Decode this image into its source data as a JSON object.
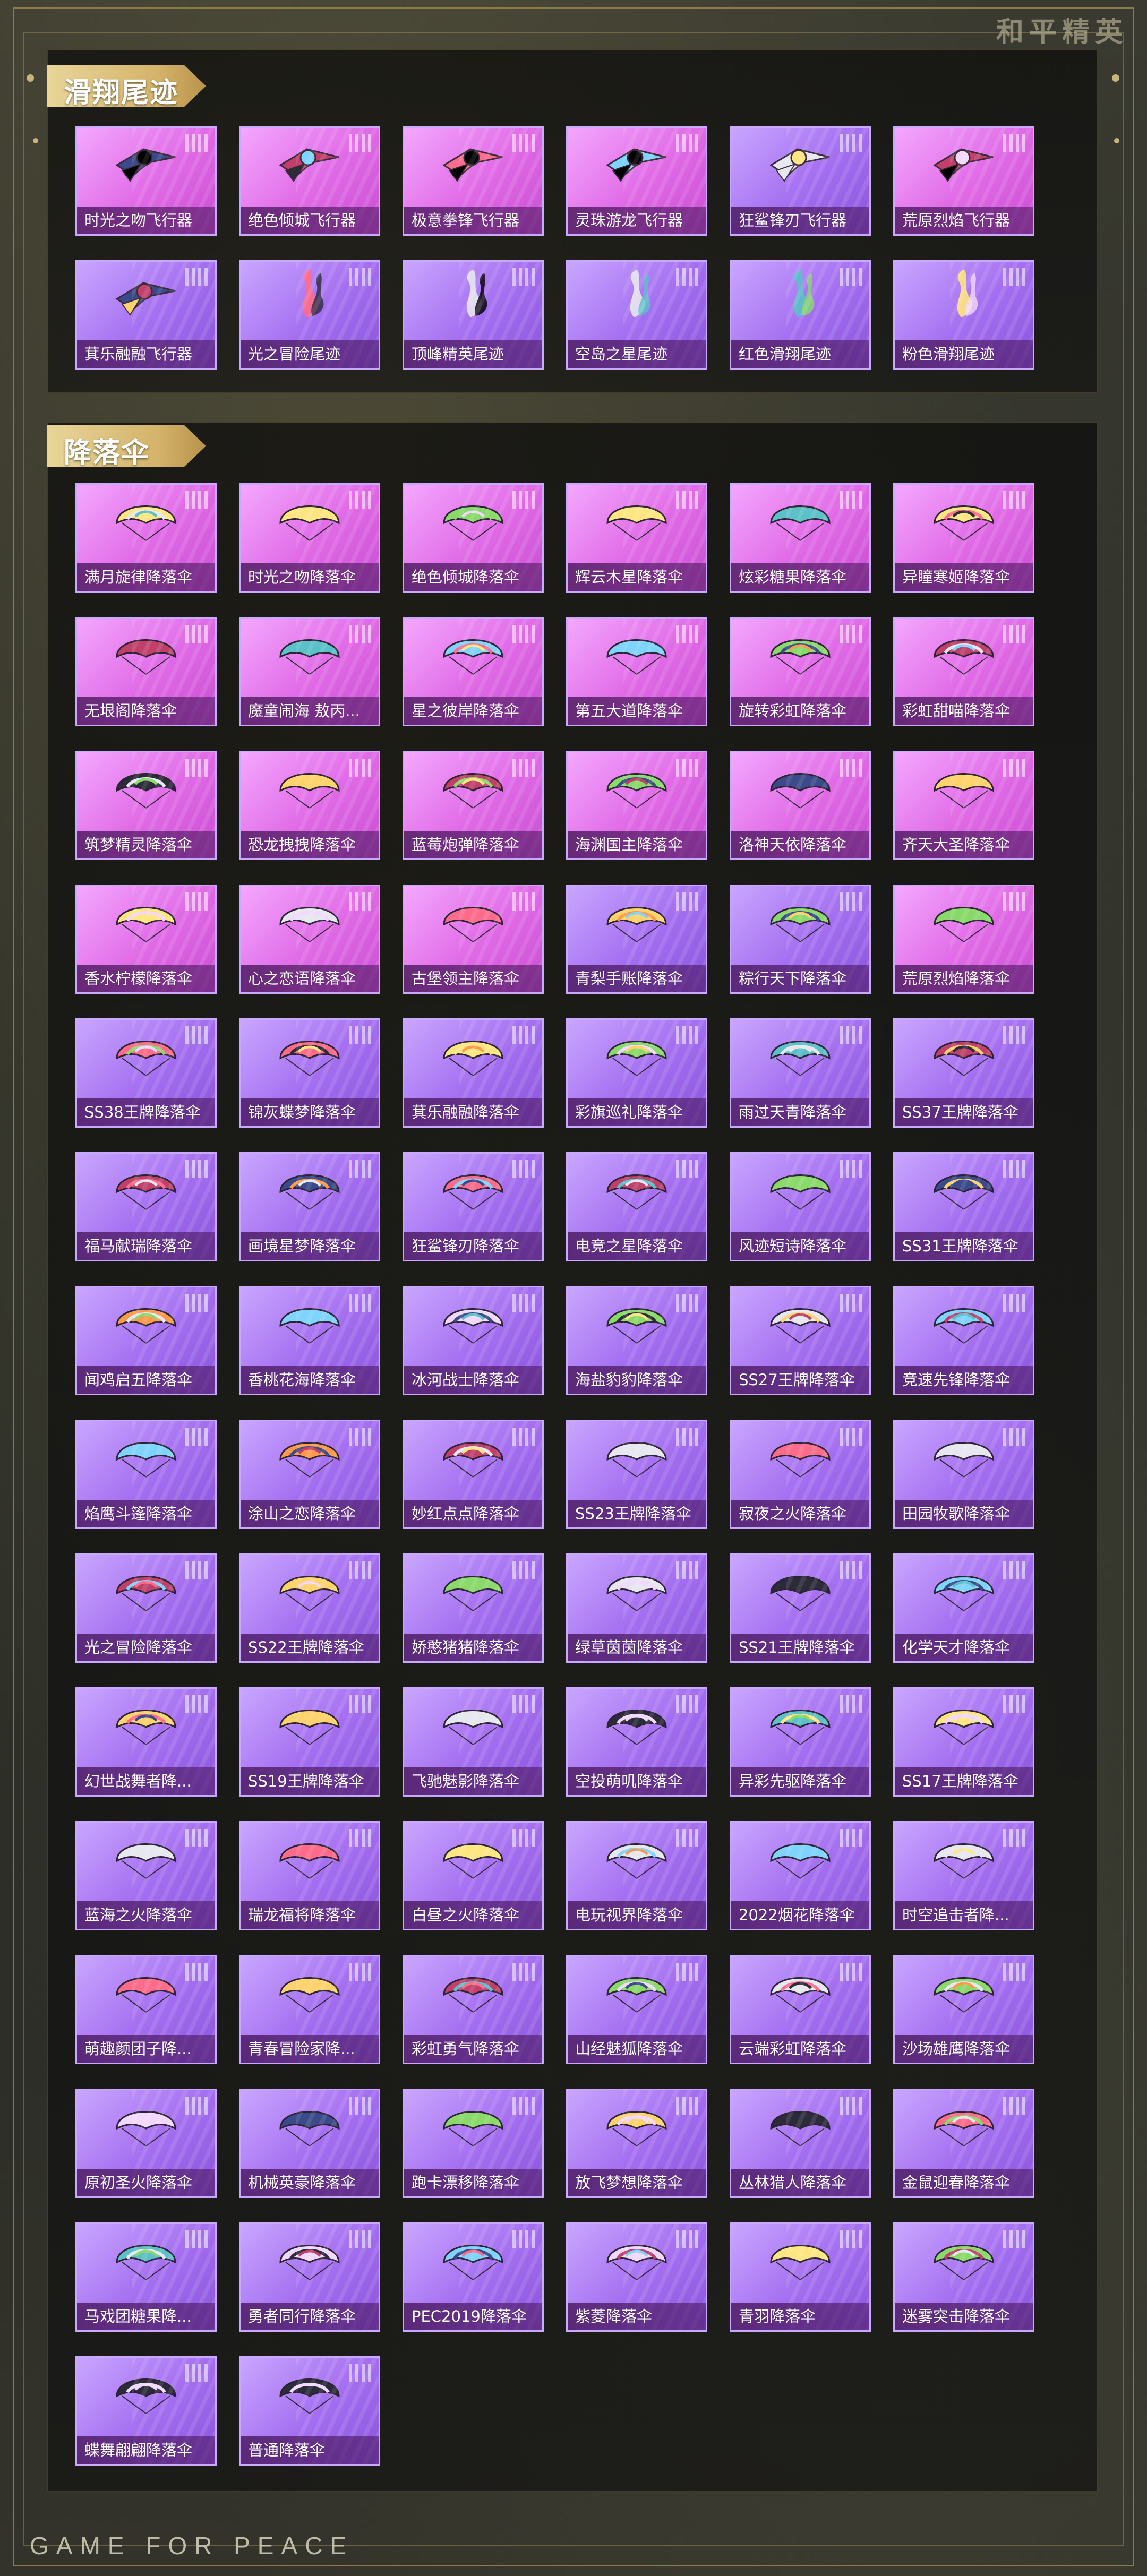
{
  "brand": {
    "corner_title": "和平精英",
    "footer": "GAME FOR PEACE"
  },
  "sections": [
    {
      "title": "滑翔尾迹",
      "items": [
        {
          "name": "时光之吻飞行器",
          "icon": "glider-icon",
          "bg": "pink"
        },
        {
          "name": "绝色倾城飞行器",
          "icon": "glider-icon",
          "bg": "pink"
        },
        {
          "name": "极意拳锋飞行器",
          "icon": "glider-icon",
          "bg": "pink"
        },
        {
          "name": "灵珠游龙飞行器",
          "icon": "glider-icon",
          "bg": "pink"
        },
        {
          "name": "狂鲨锋刃飞行器",
          "icon": "glider-icon",
          "bg": "purple"
        },
        {
          "name": "荒原烈焰飞行器",
          "icon": "glider-icon",
          "bg": "pink"
        },
        {
          "name": "萁乐融融飞行器",
          "icon": "glider-icon",
          "bg": "purple"
        },
        {
          "name": "光之冒险尾迹",
          "icon": "trail-icon",
          "bg": "purple"
        },
        {
          "name": "顶峰精英尾迹",
          "icon": "trail-icon",
          "bg": "purple"
        },
        {
          "name": "空岛之星尾迹",
          "icon": "trail-icon",
          "bg": "purple"
        },
        {
          "name": "红色滑翔尾迹",
          "icon": "trail-icon",
          "bg": "purple"
        },
        {
          "name": "粉色滑翔尾迹",
          "icon": "trail-icon",
          "bg": "purple"
        }
      ]
    },
    {
      "title": "降落伞",
      "items": [
        {
          "name": "满月旋律降落伞",
          "icon": "parachute-icon",
          "bg": "pink"
        },
        {
          "name": "时光之吻降落伞",
          "icon": "parachute-icon",
          "bg": "pink"
        },
        {
          "name": "绝色倾城降落伞",
          "icon": "parachute-icon",
          "bg": "pink"
        },
        {
          "name": "辉云木星降落伞",
          "icon": "parachute-icon",
          "bg": "pink"
        },
        {
          "name": "炫彩糖果降落伞",
          "icon": "parachute-icon",
          "bg": "pink"
        },
        {
          "name": "异瞳寒姬降落伞",
          "icon": "parachute-icon",
          "bg": "pink"
        },
        {
          "name": "无垠阁降落伞",
          "icon": "parachute-icon",
          "bg": "pink"
        },
        {
          "name": "魔童闹海 敖丙...",
          "icon": "parachute-icon",
          "bg": "pink"
        },
        {
          "name": "星之彼岸降落伞",
          "icon": "parachute-icon",
          "bg": "pink"
        },
        {
          "name": "第五大道降落伞",
          "icon": "parachute-icon",
          "bg": "pink"
        },
        {
          "name": "旋转彩虹降落伞",
          "icon": "parachute-icon",
          "bg": "pink"
        },
        {
          "name": "彩虹甜喵降落伞",
          "icon": "parachute-icon",
          "bg": "pink"
        },
        {
          "name": "筑梦精灵降落伞",
          "icon": "parachute-icon",
          "bg": "pink"
        },
        {
          "name": "恐龙拽拽降落伞",
          "icon": "parachute-icon",
          "bg": "pink"
        },
        {
          "name": "蓝莓炮弹降落伞",
          "icon": "parachute-icon",
          "bg": "pink"
        },
        {
          "name": "海渊国主降落伞",
          "icon": "parachute-icon",
          "bg": "pink"
        },
        {
          "name": "洛神天依降落伞",
          "icon": "parachute-icon",
          "bg": "pink"
        },
        {
          "name": "齐天大圣降落伞",
          "icon": "parachute-icon",
          "bg": "pink"
        },
        {
          "name": "香水柠檬降落伞",
          "icon": "parachute-icon",
          "bg": "pink"
        },
        {
          "name": "心之恋语降落伞",
          "icon": "parachute-icon",
          "bg": "pink"
        },
        {
          "name": "古堡领主降落伞",
          "icon": "parachute-icon",
          "bg": "pink"
        },
        {
          "name": "青梨手账降落伞",
          "icon": "parachute-icon",
          "bg": "purple"
        },
        {
          "name": "粽行天下降落伞",
          "icon": "parachute-icon",
          "bg": "purple"
        },
        {
          "name": "荒原烈焰降落伞",
          "icon": "parachute-icon",
          "bg": "pink"
        },
        {
          "name": "SS38王牌降落伞",
          "icon": "parachute-icon",
          "bg": "purple"
        },
        {
          "name": "锦灰蝶梦降落伞",
          "icon": "parachute-icon",
          "bg": "purple"
        },
        {
          "name": "萁乐融融降落伞",
          "icon": "parachute-icon",
          "bg": "purple"
        },
        {
          "name": "彩旗巡礼降落伞",
          "icon": "parachute-icon",
          "bg": "purple"
        },
        {
          "name": "雨过天青降落伞",
          "icon": "parachute-icon",
          "bg": "purple"
        },
        {
          "name": "SS37王牌降落伞",
          "icon": "parachute-icon",
          "bg": "purple"
        },
        {
          "name": "福马献瑞降落伞",
          "icon": "parachute-icon",
          "bg": "purple"
        },
        {
          "name": "画境星梦降落伞",
          "icon": "parachute-icon",
          "bg": "purple"
        },
        {
          "name": "狂鲨锋刃降落伞",
          "icon": "parachute-icon",
          "bg": "purple"
        },
        {
          "name": "电竞之星降落伞",
          "icon": "parachute-icon",
          "bg": "purple"
        },
        {
          "name": "风迹短诗降落伞",
          "icon": "parachute-icon",
          "bg": "purple"
        },
        {
          "name": "SS31王牌降落伞",
          "icon": "parachute-icon",
          "bg": "purple"
        },
        {
          "name": "闻鸡启五降落伞",
          "icon": "parachute-icon",
          "bg": "purple"
        },
        {
          "name": "香桃花海降落伞",
          "icon": "parachute-icon",
          "bg": "purple"
        },
        {
          "name": "冰河战士降落伞",
          "icon": "parachute-icon",
          "bg": "purple"
        },
        {
          "name": "海盐豹豹降落伞",
          "icon": "parachute-icon",
          "bg": "purple"
        },
        {
          "name": "SS27王牌降落伞",
          "icon": "parachute-icon",
          "bg": "purple"
        },
        {
          "name": "竞速先锋降落伞",
          "icon": "parachute-icon",
          "bg": "purple"
        },
        {
          "name": "焰鹰斗篷降落伞",
          "icon": "parachute-icon",
          "bg": "purple"
        },
        {
          "name": "涂山之恋降落伞",
          "icon": "parachute-icon",
          "bg": "purple"
        },
        {
          "name": "妙红点点降落伞",
          "icon": "parachute-icon",
          "bg": "purple"
        },
        {
          "name": "SS23王牌降落伞",
          "icon": "parachute-icon",
          "bg": "purple"
        },
        {
          "name": "寂夜之火降落伞",
          "icon": "parachute-icon",
          "bg": "purple"
        },
        {
          "name": "田园牧歌降落伞",
          "icon": "parachute-icon",
          "bg": "purple"
        },
        {
          "name": "光之冒险降落伞",
          "icon": "parachute-icon",
          "bg": "purple"
        },
        {
          "name": "SS22王牌降落伞",
          "icon": "parachute-icon",
          "bg": "purple"
        },
        {
          "name": "娇憨猪猪降落伞",
          "icon": "parachute-icon",
          "bg": "purple"
        },
        {
          "name": "绿草茵茵降落伞",
          "icon": "parachute-icon",
          "bg": "purple"
        },
        {
          "name": "SS21王牌降落伞",
          "icon": "parachute-icon",
          "bg": "purple"
        },
        {
          "name": "化学天才降落伞",
          "icon": "parachute-icon",
          "bg": "purple"
        },
        {
          "name": "幻世战舞者降...",
          "icon": "parachute-icon",
          "bg": "purple"
        },
        {
          "name": "SS19王牌降落伞",
          "icon": "parachute-icon",
          "bg": "purple"
        },
        {
          "name": "飞驰魅影降落伞",
          "icon": "parachute-icon",
          "bg": "purple"
        },
        {
          "name": "空投萌叽降落伞",
          "icon": "parachute-icon",
          "bg": "purple"
        },
        {
          "name": "异彩先驱降落伞",
          "icon": "parachute-icon",
          "bg": "purple"
        },
        {
          "name": "SS17王牌降落伞",
          "icon": "parachute-icon",
          "bg": "purple"
        },
        {
          "name": "蓝海之火降落伞",
          "icon": "parachute-icon",
          "bg": "purple"
        },
        {
          "name": "瑞龙福将降落伞",
          "icon": "parachute-icon",
          "bg": "purple"
        },
        {
          "name": "白昼之火降落伞",
          "icon": "parachute-icon",
          "bg": "purple"
        },
        {
          "name": "电玩视界降落伞",
          "icon": "parachute-icon",
          "bg": "purple"
        },
        {
          "name": "2022烟花降落伞",
          "icon": "parachute-icon",
          "bg": "purple"
        },
        {
          "name": "时空追击者降...",
          "icon": "parachute-icon",
          "bg": "purple"
        },
        {
          "name": "萌趣颜团子降...",
          "icon": "parachute-icon",
          "bg": "purple"
        },
        {
          "name": "青春冒险家降...",
          "icon": "parachute-icon",
          "bg": "purple"
        },
        {
          "name": "彩虹勇气降落伞",
          "icon": "parachute-icon",
          "bg": "purple"
        },
        {
          "name": "山经魅狐降落伞",
          "icon": "parachute-icon",
          "bg": "purple"
        },
        {
          "name": "云端彩虹降落伞",
          "icon": "parachute-icon",
          "bg": "purple"
        },
        {
          "name": "沙场雄鹰降落伞",
          "icon": "parachute-icon",
          "bg": "purple"
        },
        {
          "name": "原初圣火降落伞",
          "icon": "parachute-icon",
          "bg": "purple"
        },
        {
          "name": "机械英豪降落伞",
          "icon": "parachute-icon",
          "bg": "purple"
        },
        {
          "name": "跑卡漂移降落伞",
          "icon": "parachute-icon",
          "bg": "purple"
        },
        {
          "name": "放飞梦想降落伞",
          "icon": "parachute-icon",
          "bg": "purple"
        },
        {
          "name": "丛林猎人降落伞",
          "icon": "parachute-icon",
          "bg": "purple"
        },
        {
          "name": "金鼠迎春降落伞",
          "icon": "parachute-icon",
          "bg": "purple"
        },
        {
          "name": "马戏团糖果降...",
          "icon": "parachute-icon",
          "bg": "purple"
        },
        {
          "name": "勇者同行降落伞",
          "icon": "parachute-icon",
          "bg": "purple"
        },
        {
          "name": "PEC2019降落伞",
          "icon": "parachute-icon",
          "bg": "purple"
        },
        {
          "name": "紫菱降落伞",
          "icon": "parachute-icon",
          "bg": "purple"
        },
        {
          "name": "青羽降落伞",
          "icon": "parachute-icon",
          "bg": "purple"
        },
        {
          "name": "迷雾突击降落伞",
          "icon": "parachute-icon",
          "bg": "purple"
        },
        {
          "name": "蝶舞翩翩降落伞",
          "icon": "parachute-icon",
          "bg": "purple"
        },
        {
          "name": "普通降落伞",
          "icon": "parachute-icon",
          "bg": "purple"
        }
      ]
    }
  ],
  "palette": {
    "pink_bg": "#e06ae6",
    "purple_bg": "#a46ef0",
    "gold_header": "#d4b36a",
    "border": "#c9a8ff",
    "canopy_colors": [
      "#f2d8ff",
      "#ffd36b",
      "#7fd3ff",
      "#3a4a8a",
      "#ff6b8a",
      "#8ad96b",
      "#2b2b3a",
      "#ff9a4a",
      "#e7e7f0",
      "#c0406a",
      "#5bc0c8",
      "#ffe680"
    ]
  }
}
